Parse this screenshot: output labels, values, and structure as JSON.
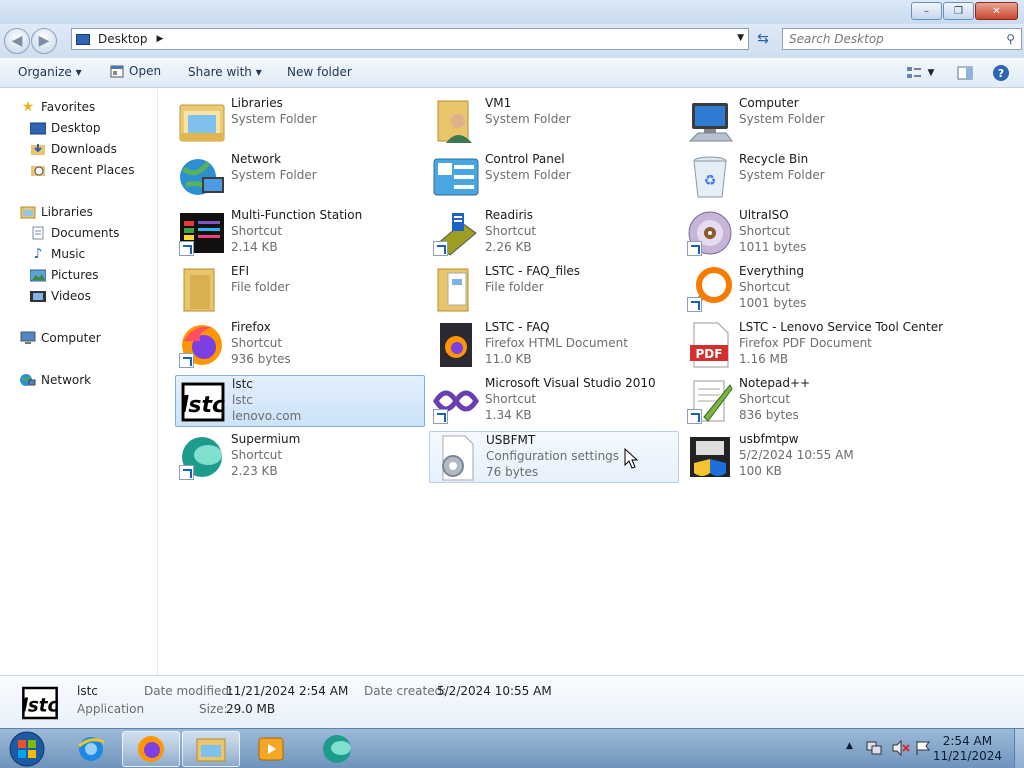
{
  "window": {
    "min": "–",
    "max": "❐",
    "close": "✕"
  },
  "address": {
    "location": "Desktop",
    "arrow": "▶",
    "dropdown": "▼"
  },
  "search": {
    "placeholder": "Search Desktop"
  },
  "toolbar": {
    "organize": "Organize ▾",
    "open": "Open",
    "share": "Share with ▾",
    "new_folder": "New folder"
  },
  "sidebar": {
    "favorites": "Favorites",
    "desktop": "Desktop",
    "downloads": "Downloads",
    "recent": "Recent Places",
    "libraries": "Libraries",
    "documents": "Documents",
    "music": "Music",
    "pictures": "Pictures",
    "videos": "Videos",
    "computer": "Computer",
    "network": "Network"
  },
  "items": [
    {
      "name": "Libraries",
      "l2": "System Folder",
      "l3": ""
    },
    {
      "name": "VM1",
      "l2": "System Folder",
      "l3": ""
    },
    {
      "name": "Computer",
      "l2": "System Folder",
      "l3": ""
    },
    {
      "name": "Network",
      "l2": "System Folder",
      "l3": ""
    },
    {
      "name": "Control Panel",
      "l2": "System Folder",
      "l3": ""
    },
    {
      "name": "Recycle Bin",
      "l2": "System Folder",
      "l3": ""
    },
    {
      "name": "Multi-Function Station",
      "l2": "Shortcut",
      "l3": "2.14 KB"
    },
    {
      "name": "Readiris",
      "l2": "Shortcut",
      "l3": "2.26 KB"
    },
    {
      "name": "UltraISO",
      "l2": "Shortcut",
      "l3": "1011 bytes"
    },
    {
      "name": "EFI",
      "l2": "File folder",
      "l3": ""
    },
    {
      "name": "LSTC - FAQ_files",
      "l2": "File folder",
      "l3": ""
    },
    {
      "name": "Everything",
      "l2": "Shortcut",
      "l3": "1001 bytes"
    },
    {
      "name": "Firefox",
      "l2": "Shortcut",
      "l3": "936 bytes"
    },
    {
      "name": "LSTC - FAQ",
      "l2": "Firefox HTML Document",
      "l3": "11.0 KB"
    },
    {
      "name": "LSTC - Lenovo Service Tool Center",
      "l2": "Firefox PDF Document",
      "l3": "1.16 MB"
    },
    {
      "name": "lstc",
      "l2": "lstc",
      "l3": "lenovo.com"
    },
    {
      "name": "Microsoft Visual Studio 2010",
      "l2": "Shortcut",
      "l3": "1.34 KB"
    },
    {
      "name": "Notepad++",
      "l2": "Shortcut",
      "l3": "836 bytes"
    },
    {
      "name": "Supermium",
      "l2": "Shortcut",
      "l3": "2.23 KB"
    },
    {
      "name": "USBFMT",
      "l2": "Configuration settings",
      "l3": "76 bytes"
    },
    {
      "name": "usbfmtpw",
      "l2": "5/2/2024 10:55 AM",
      "l3": "100 KB"
    }
  ],
  "icons": {
    "pdf_label": "PDF",
    "lstc_logo": "lstc"
  },
  "details": {
    "name": "lstc",
    "type": "Application",
    "modified_label": "Date modified:",
    "modified": "11/21/2024 2:54 AM",
    "created_label": "Date created:",
    "created": "5/2/2024 10:55 AM",
    "size_label": "Size:",
    "size": "29.0 MB"
  },
  "clock": {
    "time": "2:54 AM",
    "date": "11/21/2024"
  }
}
